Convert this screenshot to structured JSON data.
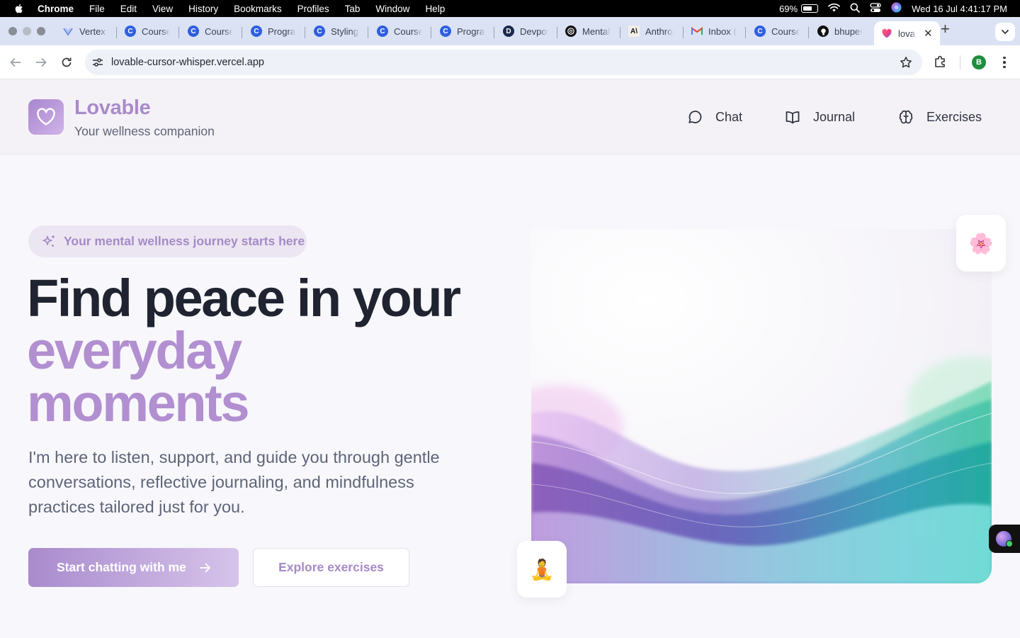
{
  "menubar": {
    "app_name": "Chrome",
    "items": [
      "File",
      "Edit",
      "View",
      "History",
      "Bookmarks",
      "Profiles",
      "Tab",
      "Window",
      "Help"
    ],
    "battery_percent_label": "69%",
    "battery_level": 0.69,
    "datetime": "Wed 16 Jul  4:41:17 PM"
  },
  "tabs": [
    {
      "title": "Vertex",
      "icon": "vertex-icon",
      "color": "#6b8ee8"
    },
    {
      "title": "Course",
      "icon": "c-icon",
      "color": "#2f5fe0"
    },
    {
      "title": "Course",
      "icon": "c-icon",
      "color": "#2f5fe0"
    },
    {
      "title": "Program",
      "icon": "c-icon",
      "color": "#2f5fe0"
    },
    {
      "title": "Styling",
      "icon": "c-icon",
      "color": "#2f5fe0"
    },
    {
      "title": "Course",
      "icon": "c-icon",
      "color": "#2f5fe0"
    },
    {
      "title": "Program",
      "icon": "c-icon",
      "color": "#2f5fe0"
    },
    {
      "title": "Devpos",
      "icon": "d-icon",
      "color": "#1b2a4a"
    },
    {
      "title": "Mental",
      "icon": "openai-icon",
      "color": "#111111"
    },
    {
      "title": "Anthrop",
      "icon": "anthropic-icon",
      "color": "#f2efe8"
    },
    {
      "title": "Inbox (",
      "icon": "gmail-icon",
      "color": "#ffffff"
    },
    {
      "title": "Course",
      "icon": "c-icon",
      "color": "#2f5fe0"
    },
    {
      "title": "bhupes",
      "icon": "github-icon",
      "color": "#111111"
    }
  ],
  "active_tab": {
    "title": "lova",
    "icon": "lovable-heart-icon"
  },
  "address_bar": {
    "url": "lovable-cursor-whisper.vercel.app"
  },
  "profile_initial": "B",
  "app": {
    "brand_name": "Lovable",
    "brand_tagline": "Your wellness companion",
    "nav": [
      {
        "label": "Chat",
        "icon": "chat-bubble-icon"
      },
      {
        "label": "Journal",
        "icon": "book-open-icon"
      },
      {
        "label": "Exercises",
        "icon": "brain-icon"
      }
    ],
    "hero": {
      "pill_text": "Your mental wellness journey starts here",
      "headline_line1": "Find peace in your",
      "headline_line2": "everyday",
      "headline_line3": "moments",
      "subtext": "I'm here to listen, support, and guide you through gentle conversations, reflective journaling, and mindfulness practices tailored just for you.",
      "primary_cta": "Start chatting with me",
      "secondary_cta": "Explore exercises",
      "flower_emoji": "🌸",
      "meditation_emoji": "🧘"
    },
    "colors": {
      "accent": "#b18fd0",
      "brand_text": "#a98acb",
      "headline": "#1f2430"
    }
  }
}
